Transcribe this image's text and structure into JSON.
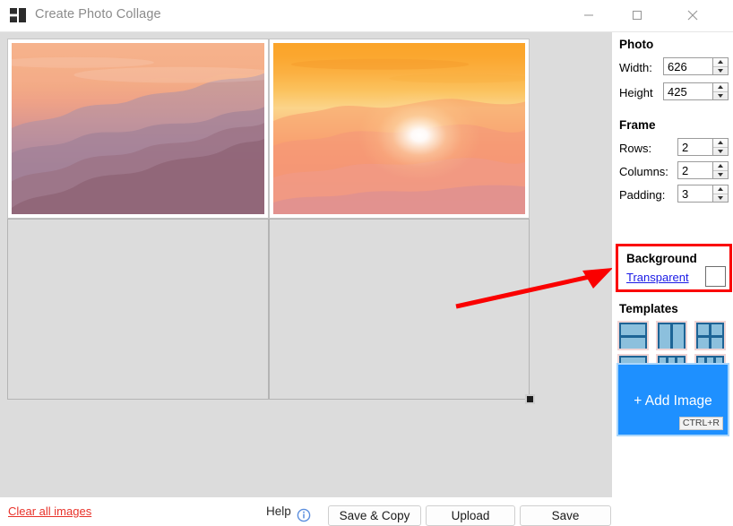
{
  "window": {
    "title": "Create Photo Collage",
    "icon": "collage-grid-icon",
    "minimize_label": "—",
    "maximize_label": "□",
    "close_label": "✕"
  },
  "panel": {
    "photo": {
      "title": "Photo",
      "width_label": "Width:",
      "width_value": "626",
      "height_label": "Height",
      "height_value": "425"
    },
    "frame": {
      "title": "Frame",
      "rows_label": "Rows:",
      "rows_value": "2",
      "columns_label": "Columns:",
      "columns_value": "2",
      "padding_label": "Padding:",
      "padding_value": "3"
    },
    "background": {
      "title": "Background",
      "transparent_label": "Transparent",
      "swatch_color": "#ffffff",
      "highlight_color": "#fa0000"
    },
    "templates": {
      "title": "Templates",
      "items": [
        {
          "name": "template-2-rows",
          "cols": 1,
          "rows": 2
        },
        {
          "name": "template-2-columns",
          "cols": 2,
          "rows": 1
        },
        {
          "name": "template-2x2-grid",
          "cols": 2,
          "rows": 2
        },
        {
          "name": "template-3-rows",
          "cols": 1,
          "rows": 3
        },
        {
          "name": "template-3-columns",
          "cols": 3,
          "rows": 1
        },
        {
          "name": "template-3x3-grid",
          "cols": 3,
          "rows": 3
        }
      ]
    },
    "add_image": {
      "label": "+ Add Image",
      "shortcut": "CTRL+R",
      "color": "#1e90ff"
    }
  },
  "canvas": {
    "cells": [
      {
        "name": "collage-cell-1",
        "filled": true,
        "photo": "mountain-ridges-at-dusk"
      },
      {
        "name": "collage-cell-2",
        "filled": true,
        "photo": "sun-over-orange-hills"
      },
      {
        "name": "collage-cell-3",
        "filled": false,
        "photo": ""
      },
      {
        "name": "collage-cell-4",
        "filled": false,
        "photo": ""
      }
    ],
    "resize_handle": "canvas-resize-handle",
    "annotation": "red-arrow-pointing-to-background-section"
  },
  "bottom": {
    "clear_all_label": "Clear all images",
    "help_label": "Help",
    "help_icon": "info-circle-icon",
    "save_copy_label": "Save & Copy",
    "upload_label": "Upload",
    "save_label": "Save"
  }
}
